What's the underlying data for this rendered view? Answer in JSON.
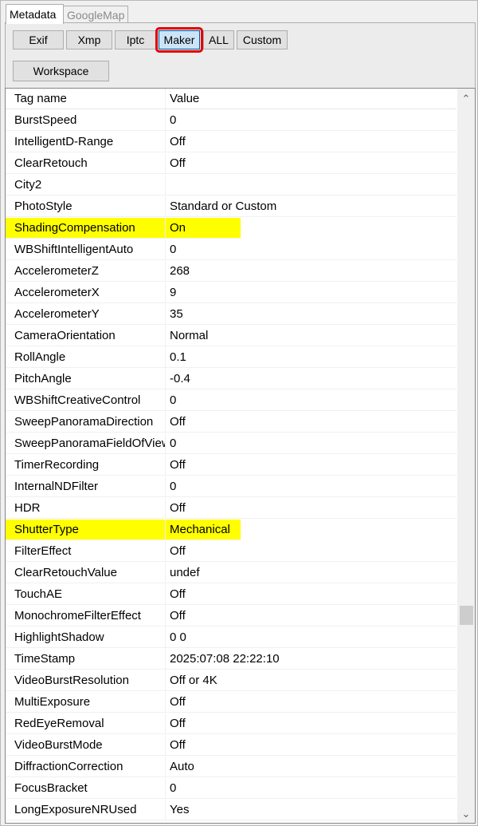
{
  "tabs": [
    "Metadata",
    "GoogleMap"
  ],
  "buttons": [
    "Exif",
    "Xmp",
    "Iptc",
    "Maker",
    "ALL",
    "Custom"
  ],
  "workspace_label": "Workspace",
  "columns": [
    "Tag name",
    "Value"
  ],
  "rows": [
    {
      "tag": "BurstSpeed",
      "value": "0"
    },
    {
      "tag": "IntelligentD-Range",
      "value": "Off"
    },
    {
      "tag": "ClearRetouch",
      "value": "Off"
    },
    {
      "tag": "City2",
      "value": ""
    },
    {
      "tag": "PhotoStyle",
      "value": "Standard or Custom"
    },
    {
      "tag": "ShadingCompensation",
      "value": "On",
      "highlight": true
    },
    {
      "tag": "WBShiftIntelligentAuto",
      "value": "0"
    },
    {
      "tag": "AccelerometerZ",
      "value": "268"
    },
    {
      "tag": "AccelerometerX",
      "value": "9"
    },
    {
      "tag": "AccelerometerY",
      "value": "35"
    },
    {
      "tag": "CameraOrientation",
      "value": "Normal"
    },
    {
      "tag": "RollAngle",
      "value": "0.1"
    },
    {
      "tag": "PitchAngle",
      "value": "-0.4"
    },
    {
      "tag": "WBShiftCreativeControl",
      "value": "0"
    },
    {
      "tag": "SweepPanoramaDirection",
      "value": "Off"
    },
    {
      "tag": "SweepPanoramaFieldOfView",
      "value": "0"
    },
    {
      "tag": "TimerRecording",
      "value": "Off"
    },
    {
      "tag": "InternalNDFilter",
      "value": "0"
    },
    {
      "tag": "HDR",
      "value": "Off"
    },
    {
      "tag": "ShutterType",
      "value": "Mechanical",
      "highlight": true
    },
    {
      "tag": "FilterEffect",
      "value": "Off"
    },
    {
      "tag": "ClearRetouchValue",
      "value": "undef"
    },
    {
      "tag": "TouchAE",
      "value": "Off"
    },
    {
      "tag": "MonochromeFilterEffect",
      "value": "Off"
    },
    {
      "tag": "HighlightShadow",
      "value": "0 0"
    },
    {
      "tag": "TimeStamp",
      "value": "2025:07:08 22:22:10"
    },
    {
      "tag": "VideoBurstResolution",
      "value": "Off or 4K"
    },
    {
      "tag": "MultiExposure",
      "value": "Off"
    },
    {
      "tag": "RedEyeRemoval",
      "value": "Off"
    },
    {
      "tag": "VideoBurstMode",
      "value": "Off"
    },
    {
      "tag": "DiffractionCorrection",
      "value": "Auto"
    },
    {
      "tag": "FocusBracket",
      "value": "0"
    },
    {
      "tag": "LongExposureNRUsed",
      "value": "Yes"
    }
  ],
  "colors": {
    "highlight": "#ffff00",
    "selected_button_outline": "#e00000"
  }
}
